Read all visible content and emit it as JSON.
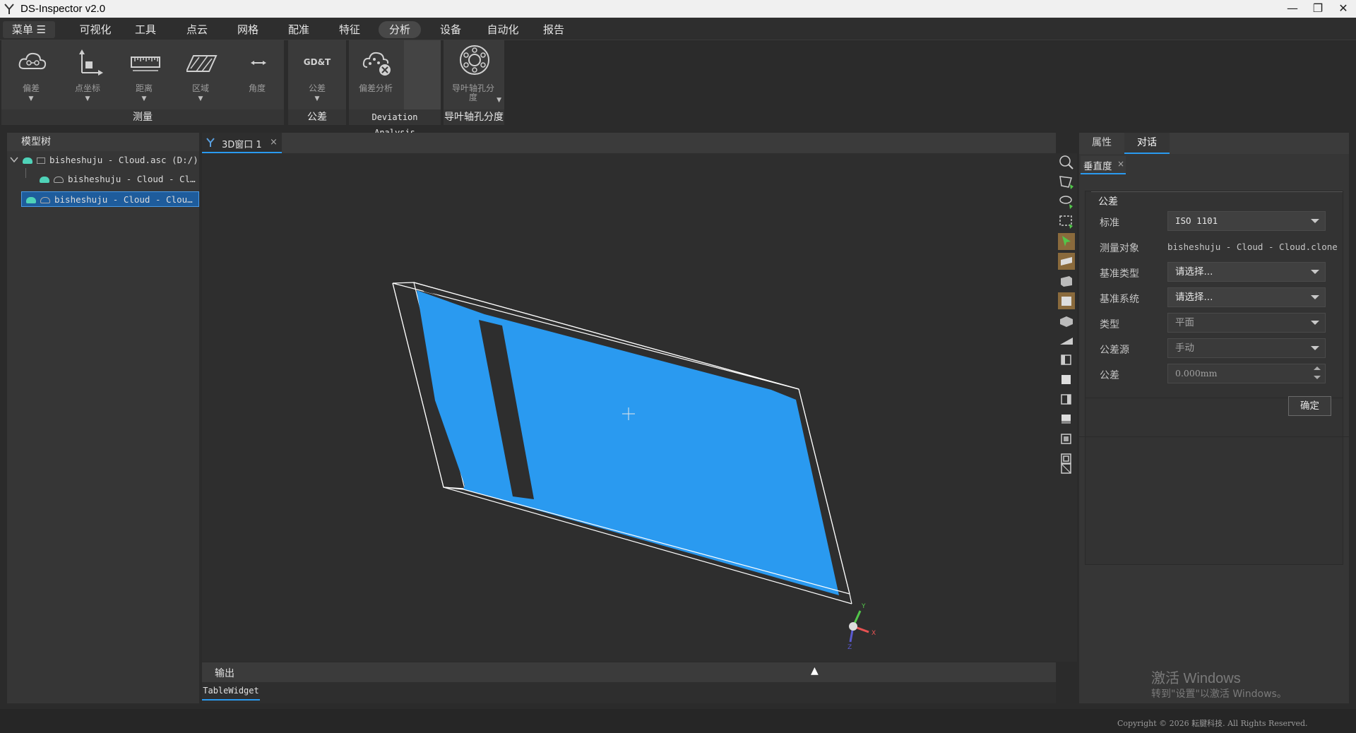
{
  "window": {
    "title": "DS-Inspector v2.0",
    "minimize": "—",
    "restore": "❐",
    "close": "✕"
  },
  "menubar": {
    "items": [
      "菜单 ☰",
      "可视化",
      "工具",
      "点云",
      "网格",
      "配准",
      "特征",
      "分析",
      "设备",
      "自动化",
      "报告"
    ],
    "active": "分析"
  },
  "ribbon": {
    "groups": [
      {
        "label": "测量",
        "buttons": [
          {
            "label": "偏差",
            "icon": "cloud-deviation-icon",
            "has_menu": true
          },
          {
            "label": "点坐标",
            "icon": "point-coordinate-icon",
            "has_menu": true
          },
          {
            "label": "距离",
            "icon": "ruler-icon",
            "has_menu": true
          },
          {
            "label": "区域",
            "icon": "area-icon",
            "has_menu": true
          },
          {
            "label": "角度",
            "icon": "angle-icon",
            "has_menu": false
          }
        ]
      },
      {
        "label": "公差",
        "buttons": [
          {
            "label": "公差",
            "icon": "gdt-icon",
            "icon_text": "GD&T",
            "has_menu": true
          }
        ]
      },
      {
        "label": "Deviation Analysis",
        "buttons": [
          {
            "label": "偏差分析",
            "icon": "deviation-analysis-icon",
            "has_menu": false
          }
        ]
      },
      {
        "label": "导叶轴孔分度",
        "buttons": [
          {
            "label": "导叶轴孔分度",
            "icon": "bearing-icon",
            "has_menu": true
          }
        ]
      }
    ]
  },
  "model_tree": {
    "title": "模型树",
    "items": [
      {
        "label": "bisheshuju - Cloud.asc (D:/)",
        "level": 0,
        "selected": false
      },
      {
        "label": "bisheshuju - Cloud - Cl…",
        "level": 1,
        "selected": false
      },
      {
        "label": "bisheshuju - Cloud - Clou…",
        "level": 1,
        "selected": true
      }
    ]
  },
  "viewport": {
    "tab_label": "3D窗口 1",
    "tab_close": "×",
    "axes": {
      "x": "X",
      "y": "Y",
      "z": "Z"
    },
    "cloud_color": "#2a9af0"
  },
  "output": {
    "title": "输出",
    "toggle": "▲",
    "tab_label": "TableWidget"
  },
  "right_panel": {
    "tabs": [
      "属性",
      "对话"
    ],
    "active_tab": "对话",
    "subtab": "垂直度",
    "subtab_close": "×",
    "section": "公差",
    "fields": [
      {
        "label": "标准",
        "value": "ISO 1101",
        "kind": "combo",
        "enabled": true
      },
      {
        "label": "测量对象",
        "value": "bisheshuju - Cloud - Cloud.clone",
        "kind": "text"
      },
      {
        "label": "基准类型",
        "value": "请选择...",
        "kind": "combo",
        "enabled": true
      },
      {
        "label": "基准系统",
        "value": "请选择...",
        "kind": "combo",
        "enabled": true
      },
      {
        "label": "类型",
        "value": "平面",
        "kind": "combo",
        "enabled": false
      },
      {
        "label": "公差源",
        "value": "手动",
        "kind": "combo",
        "enabled": false
      },
      {
        "label": "公差",
        "value": "0.000mm",
        "kind": "spin",
        "enabled": false
      }
    ],
    "confirm": "确定"
  },
  "watermark": {
    "line1": "激活 Windows",
    "line2": "转到\"设置\"以激活 Windows。"
  },
  "statusbar": {
    "copyright": "Copyright © 2026 耘腱科技. All Rights Reserved."
  }
}
